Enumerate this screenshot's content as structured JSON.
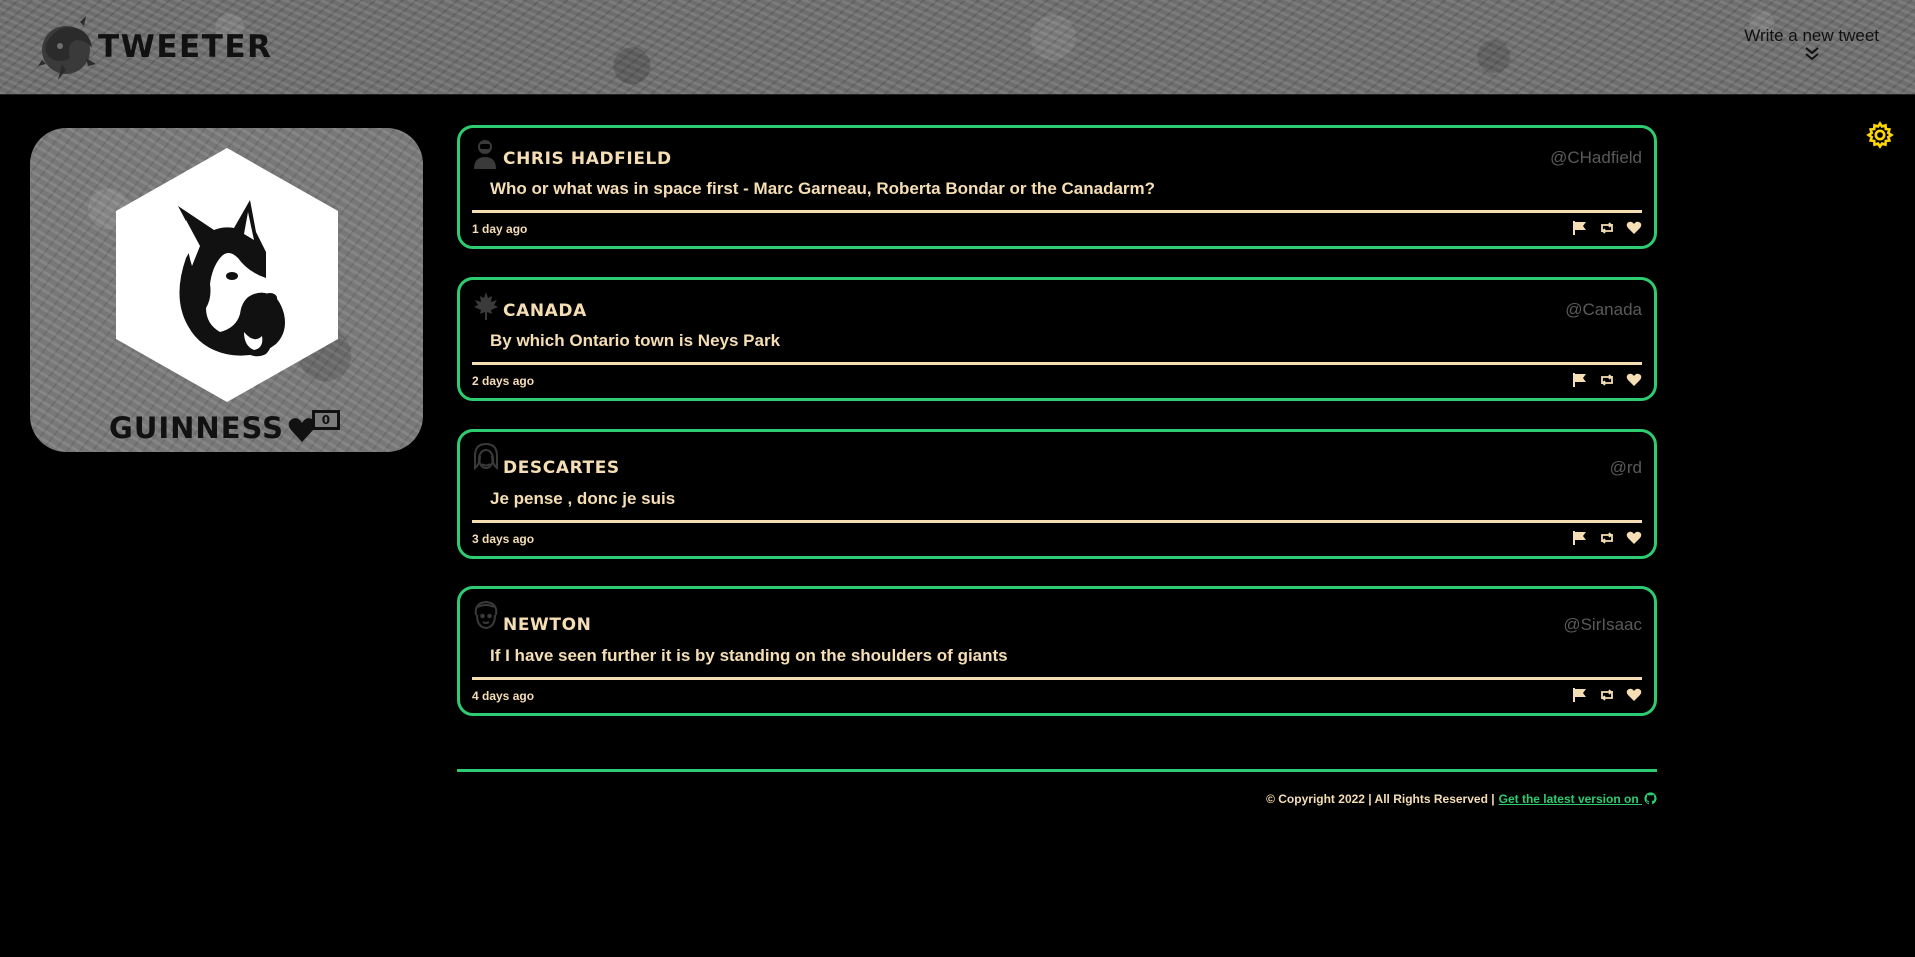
{
  "header": {
    "brand": "TWEETER",
    "compose_label": "Write  a new tweet"
  },
  "profile": {
    "name": "GUINNESS",
    "likes": "0"
  },
  "tweets": [
    {
      "name": "Chris Hadfield",
      "handle": "@CHadfield",
      "content": "Who or what was in space first - Marc Garneau, Roberta Bondar or the Canadarm?",
      "time": "1 day ago",
      "avatar": "astronaut-icon"
    },
    {
      "name": "Canada",
      "handle": "@Canada",
      "content": "By which Ontario town is Neys Park",
      "time": "2 days ago",
      "avatar": "maple-leaf-icon"
    },
    {
      "name": "Descartes",
      "handle": "@rd",
      "content": "Je pense , donc je suis",
      "time": "3 days ago",
      "avatar": "descartes-face-icon"
    },
    {
      "name": "Newton",
      "handle": "@SirIsaac",
      "content": "If I have seen further it is by standing on the shoulders of giants",
      "time": "4 days ago",
      "avatar": "newton-face-icon"
    }
  ],
  "footer": {
    "copyright": "© Copyright 2022 | All Rights Reserved |",
    "link_text": "Get the latest version on"
  },
  "colors": {
    "accent": "#2ecc71",
    "text": "#f5deb3",
    "handle": "#5a5a5a",
    "gear": "#ffd700"
  }
}
